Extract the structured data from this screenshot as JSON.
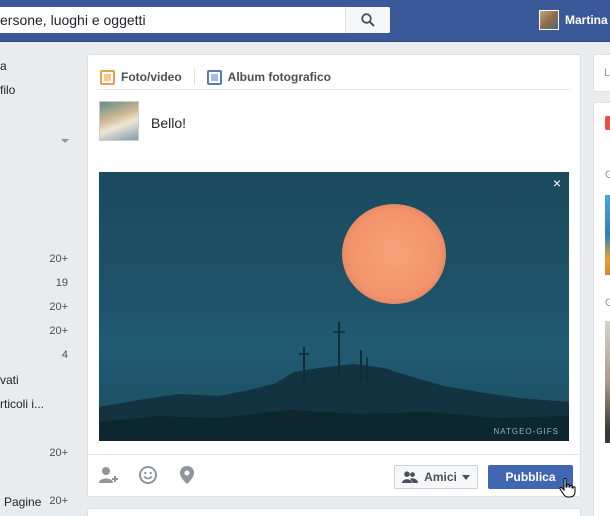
{
  "colors": {
    "brand": "#3b5998",
    "publish": "#4267b2",
    "page_bg": "#e9ebee"
  },
  "topbar": {
    "search_placeholder": "ersone, luoghi e oggetti",
    "search_icon": "search-icon",
    "user_name": "Martina"
  },
  "leftnav": {
    "items": [
      {
        "label": "a",
        "count": ""
      },
      {
        "label": "filo",
        "count": ""
      },
      {
        "label": "",
        "count": "20+"
      },
      {
        "label": "",
        "count": "19"
      },
      {
        "label": "",
        "count": "20+"
      },
      {
        "label": "",
        "count": "20+"
      },
      {
        "label": "",
        "count": "4"
      },
      {
        "label": "vati",
        "count": ""
      },
      {
        "label": "rticoli i...",
        "count": ""
      },
      {
        "label": "",
        "count": "20+"
      },
      {
        "label": "Pagine",
        "count": "20+"
      }
    ]
  },
  "composer": {
    "tab_photo": "Foto/video",
    "tab_album": "Album fotografico",
    "post_text": "Bello!",
    "gif_credit": "NATGEO-GIFS",
    "close_label": "×",
    "audience_label": "Amici",
    "publish_label": "Pubblica"
  },
  "rightcol": {
    "card1_letter": "L",
    "letter_1": "G",
    "letter_2": "G"
  }
}
